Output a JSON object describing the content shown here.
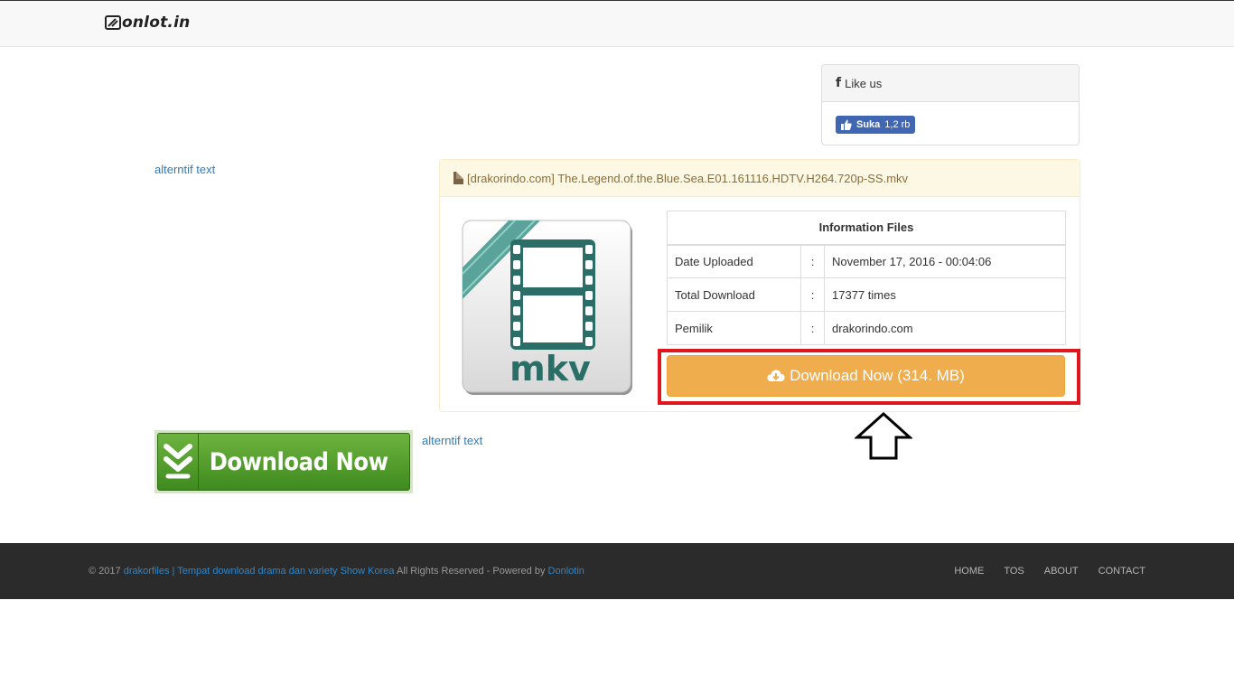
{
  "header": {
    "logo_text": "onlot.in"
  },
  "like_panel": {
    "title": "Like us",
    "fb_label": "Suka",
    "fb_count": "1,2 rb"
  },
  "alt_text_1": "alterntif text",
  "alt_text_2": "alterntif text",
  "file": {
    "name": "[drakorindo.com] The.Legend.of.the.Blue.Sea.E01.161116.HDTV.H264.720p-SS.mkv",
    "icon_label": "mkv",
    "table_title": "Information Files",
    "rows": [
      {
        "label": "Date Uploaded",
        "sep": ":",
        "value": "November 17, 2016 - 00:04:06"
      },
      {
        "label": "Total Download",
        "sep": ":",
        "value": "17377 times"
      },
      {
        "label": "Pemilik",
        "sep": ":",
        "value": "drakorindo.com"
      }
    ],
    "download_label": "Download Now (314. MB)"
  },
  "ad": {
    "label": "Download Now"
  },
  "footer": {
    "copyright": "© 2017",
    "site_link": "drakorfiles | Tempat download drama dan variety Show Korea",
    "rights": "All Rights Reserved - Powered by",
    "powered_link": "Donlotin",
    "nav": [
      "HOME",
      "TOS",
      "ABOUT",
      "CONTACT"
    ]
  },
  "colors": {
    "accent": "#f0ad4e",
    "highlight": "#e0161f",
    "link": "#337ab7",
    "footer_bg": "#2b2b2b"
  }
}
